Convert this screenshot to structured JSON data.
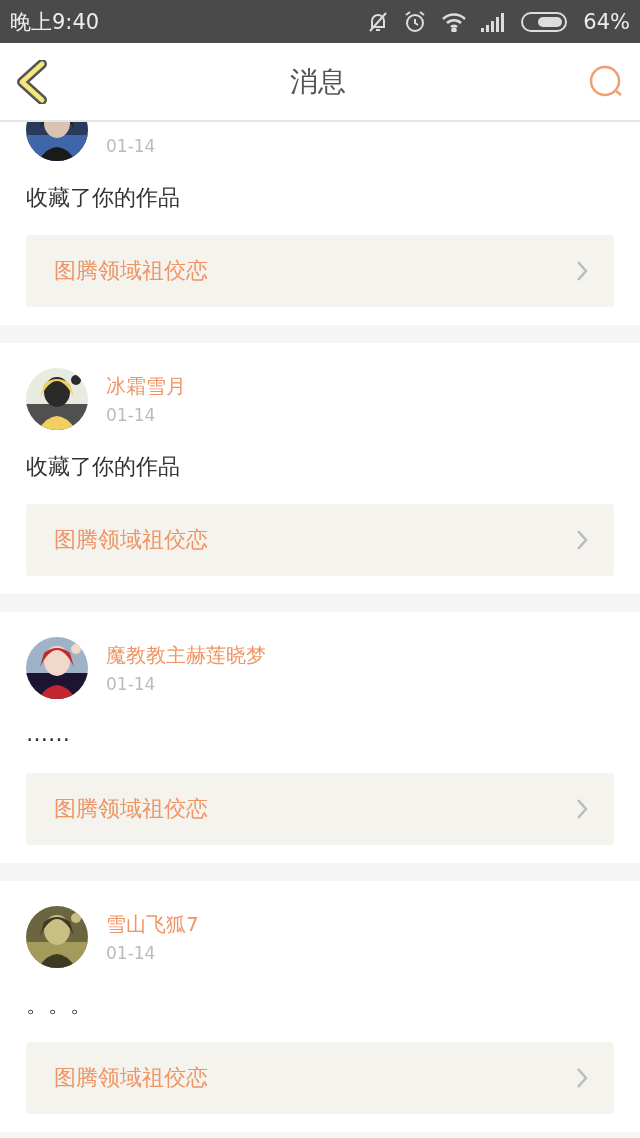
{
  "status_bar": {
    "time": "晚上9:40",
    "battery": "64%"
  },
  "header": {
    "title": "消息"
  },
  "messages": [
    {
      "date": "01-14",
      "text": "收藏了你的作品",
      "work": "图腾领域祖佼恋"
    },
    {
      "name": "冰霜雪月",
      "date": "01-14",
      "text": "收藏了你的作品",
      "work": "图腾领域祖佼恋"
    },
    {
      "name": "魔教教主赫莲晓梦",
      "date": "01-14",
      "text": "……",
      "work": "图腾领域祖佼恋"
    },
    {
      "name": "雪山飞狐7",
      "date": "01-14",
      "text": "。。。",
      "work": "图腾领域祖佼恋"
    }
  ]
}
